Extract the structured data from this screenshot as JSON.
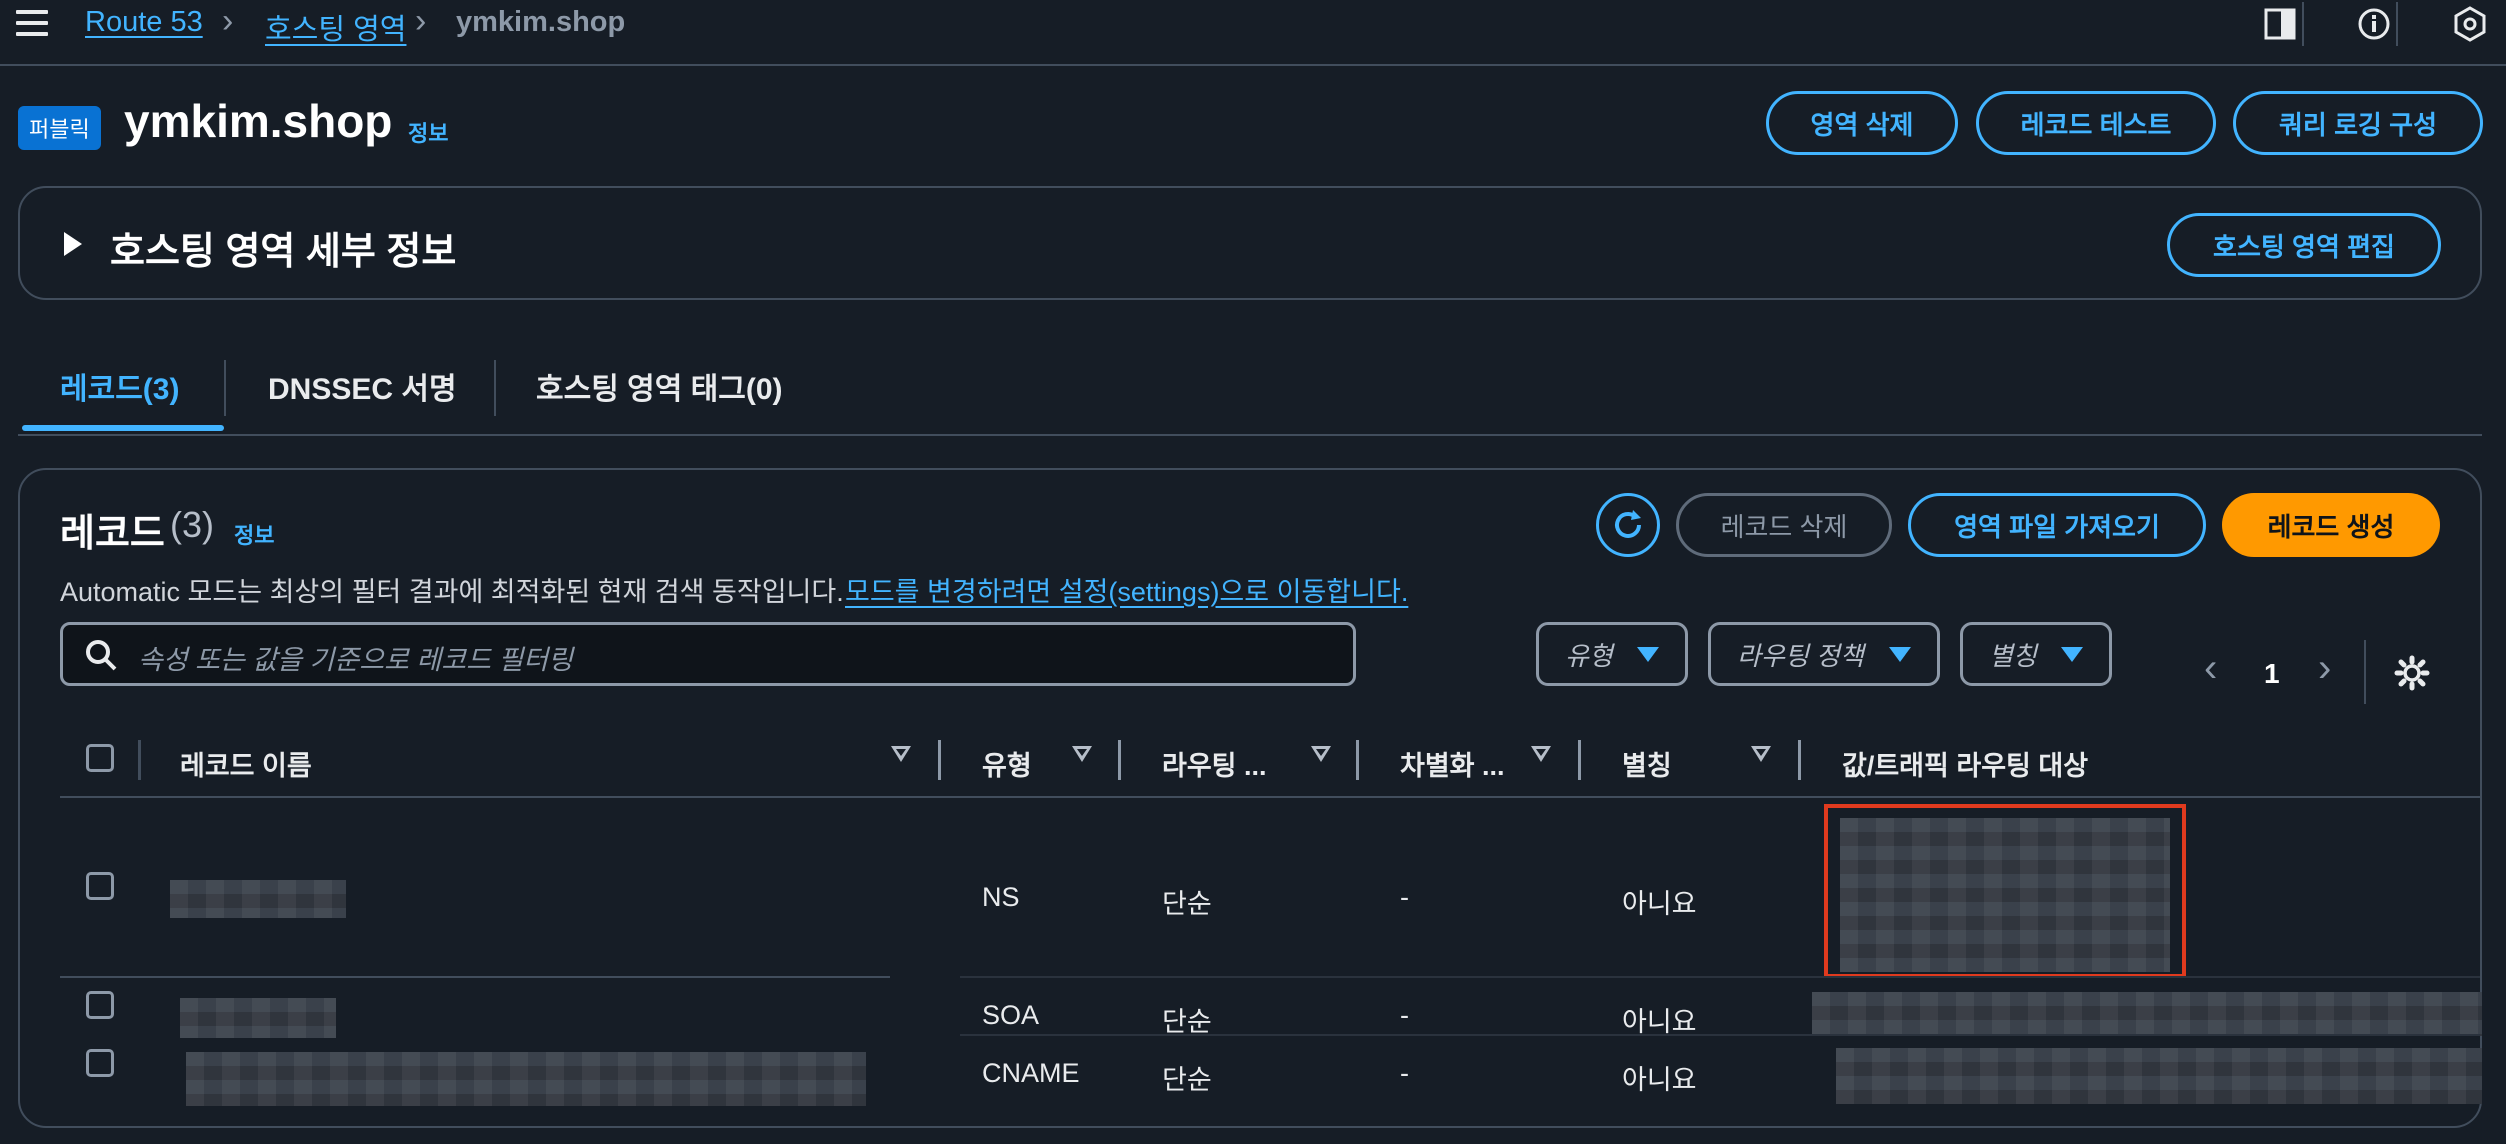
{
  "breadcrumbs": [
    "Route 53",
    "호스팅 영역",
    "ymkim.shop"
  ],
  "header": {
    "badge": "퍼블릭",
    "zone_name": "ymkim.shop",
    "info": "정보",
    "buttons": [
      "영역 삭제",
      "레코드 테스트",
      "쿼리 로깅 구성"
    ]
  },
  "details": {
    "title": "호스팅 영역 세부 정보",
    "edit_button": "호스팅 영역 편집"
  },
  "tabs": [
    "레코드(3)",
    "DNSSEC 서명",
    "호스팅 영역 태그(0)"
  ],
  "records": {
    "title": "레코드",
    "count": "(3)",
    "info": "정보",
    "delete_button": "레코드 삭제",
    "import_button": "영역 파일 가져오기",
    "create_button": "레코드 생성",
    "notice": "Automatic 모드는 최상의 필터 결과에 최적화된 현재 검색 동작입니다.",
    "notice_link": "모드를 변경하려면 설정(settings)으로 이동합니다.",
    "filter_placeholder": "속성 또는 값을 기준으로 레코드 필터링",
    "filters": [
      "유형",
      "라우팅 정책",
      "별칭"
    ],
    "page": "1",
    "columns": [
      "레코드 이름",
      "유형",
      "라우팅 ...",
      "차별화 ...",
      "별칭",
      "값/트래픽 라우팅 대상"
    ],
    "rows": [
      {
        "type": "NS",
        "routing": "단순",
        "diff": "-",
        "alias": "아니요"
      },
      {
        "type": "SOA",
        "routing": "단순",
        "diff": "-",
        "alias": "아니요"
      },
      {
        "type": "CNAME",
        "routing": "단순",
        "diff": "-",
        "alias": "아니요"
      }
    ]
  },
  "colors": {
    "background": "#161d26",
    "link": "#42b4ff",
    "primary": "#ff9900",
    "badge": "#0972d3",
    "highlight": "#e03a1e"
  }
}
